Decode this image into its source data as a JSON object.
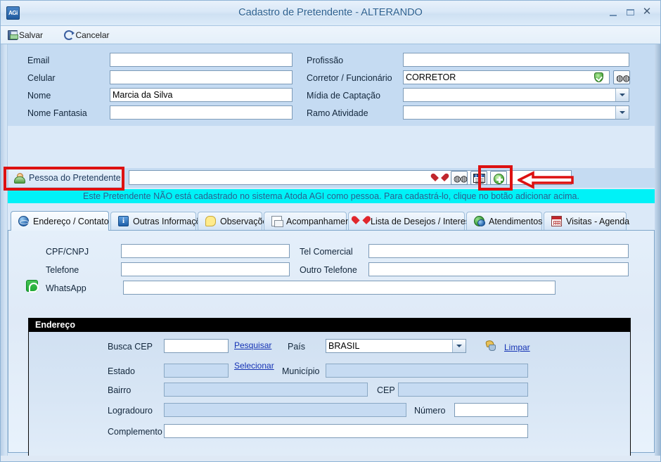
{
  "window": {
    "title": "Cadastro de Pretendente - ALTERANDO",
    "app_icon": "AGi",
    "minimize": "–",
    "maximize": "□",
    "close": "✕"
  },
  "toolbar": {
    "save_label": "Salvar",
    "cancel_label": "Cancelar"
  },
  "top_form": {
    "left": [
      {
        "label": "Email",
        "value": ""
      },
      {
        "label": "Celular",
        "value": ""
      },
      {
        "label": "Nome",
        "value": "Marcia da Silva"
      },
      {
        "label": "Nome Fantasia",
        "value": ""
      }
    ],
    "right": [
      {
        "label": "Profissão",
        "value": "",
        "kind": "text"
      },
      {
        "label": "Corretor / Funcionário",
        "value": "CORRETOR",
        "kind": "text-verified"
      },
      {
        "label": "Mídia de Captação",
        "value": "",
        "kind": "combo"
      },
      {
        "label": "Ramo Atividade",
        "value": "",
        "kind": "combo"
      }
    ]
  },
  "person_row": {
    "label": "Pessoa do Pretendente",
    "value": ""
  },
  "notice": {
    "text": "Este Pretendente NÃO está cadastrado no sistema Atoda AGI como pessoa.  Para cadastrá-lo, clique no botão adicionar acima."
  },
  "tabs": [
    {
      "label": "Endereço / Contato",
      "icon": "globe-icon",
      "active": true
    },
    {
      "label": "Outras Informações",
      "icon": "info-icon",
      "active": false
    },
    {
      "label": "Observações",
      "icon": "note-icon",
      "active": false
    },
    {
      "label": "Acompanhamento",
      "icon": "document-icon",
      "active": false
    },
    {
      "label": "Lista de Desejos / Interesses",
      "icon": "heart-icon",
      "active": false
    },
    {
      "label": "Atendimentos",
      "icon": "chat-icon",
      "active": false
    },
    {
      "label": "Visitas - Agenda",
      "icon": "calendar-icon",
      "active": false
    }
  ],
  "contact": {
    "left": [
      {
        "label": "CPF/CNPJ",
        "value": ""
      },
      {
        "label": "Telefone",
        "value": ""
      },
      {
        "label": "WhatsApp",
        "value": ""
      }
    ],
    "right": [
      {
        "label": "Tel Comercial",
        "value": ""
      },
      {
        "label": "Outro Telefone",
        "value": ""
      }
    ]
  },
  "endereco": {
    "title": "Endereço",
    "busca_cep_label": "Busca CEP",
    "busca_cep_value": "",
    "pesquisar_link": "Pesquisar",
    "pais_label": "País",
    "pais_value": "BRASIL",
    "limpar_link": "Limpar",
    "estado_label": "Estado",
    "estado_value": "",
    "selecionar_link": "Selecionar",
    "municipio_label": "Município",
    "municipio_value": "",
    "bairro_label": "Bairro",
    "bairro_value": "",
    "cep_label": "CEP",
    "cep_value": "",
    "logradouro_label": "Logradouro",
    "logradouro_value": "",
    "numero_label": "Número",
    "numero_value": "",
    "complemento_label": "Complemento",
    "complemento_value": ""
  },
  "icons": {
    "save": "save-icon",
    "cancel": "refresh-icon",
    "binoculars": "binoculars-icon",
    "shield_check": "shield-check-icon",
    "heart": "heart-icon",
    "card": "id-card-icon",
    "add": "add-circle-icon",
    "person": "person-icon",
    "whatsapp": "whatsapp-icon",
    "broom": "clear-icon"
  },
  "colors": {
    "accent": "#2a5f8f",
    "notice_bg": "#00f2f7",
    "annotation": "#dd1111",
    "panel_bg": "#c5dbf2",
    "header_bg": "#000000"
  }
}
